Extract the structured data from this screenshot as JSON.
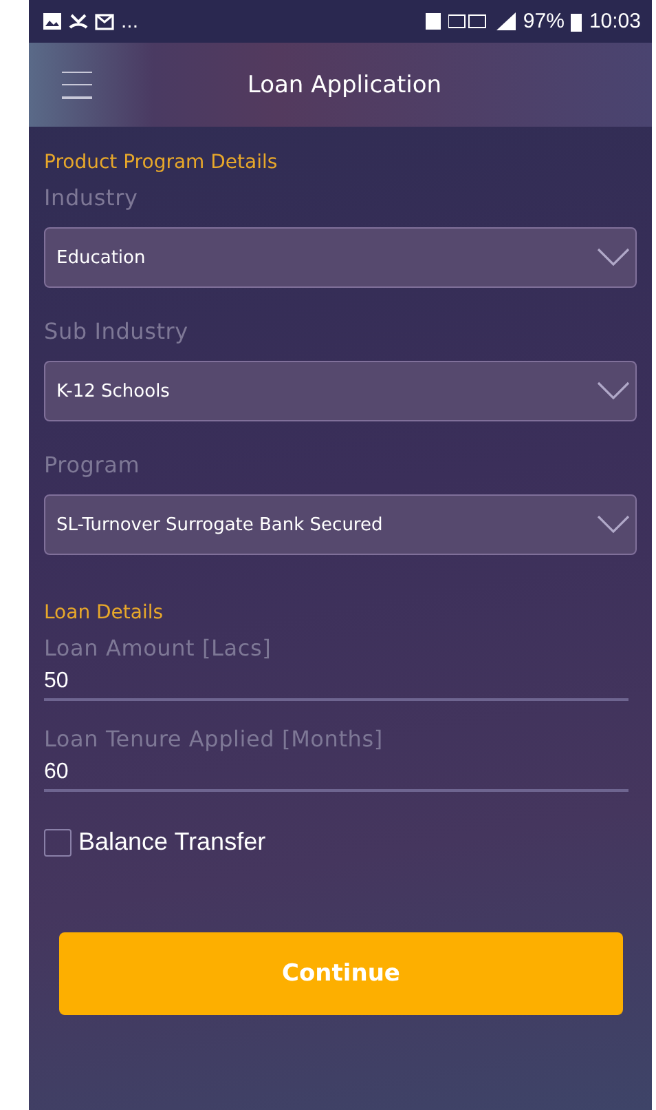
{
  "status_bar": {
    "overflow": "...",
    "battery": "97%",
    "time": "10:03"
  },
  "header": {
    "title": "Loan Application"
  },
  "sections": [
    {
      "title": "Product Program Details",
      "fields": [
        {
          "kind": "select",
          "label": "Industry",
          "value": "Education"
        },
        {
          "kind": "select",
          "label": "Sub Industry",
          "value": "K-12 Schools"
        },
        {
          "kind": "select",
          "label": "Program",
          "value": "SL-Turnover Surrogate Bank Secured"
        }
      ]
    },
    {
      "title": "Loan Details",
      "fields": [
        {
          "kind": "text",
          "label": "Loan Amount [Lacs]",
          "value": "50"
        },
        {
          "kind": "text",
          "label": "Loan Tenure Applied [Months]",
          "value": "60"
        },
        {
          "kind": "checkbox",
          "label": "Balance Transfer",
          "checked": false
        }
      ]
    }
  ],
  "primary_button": "Continue"
}
